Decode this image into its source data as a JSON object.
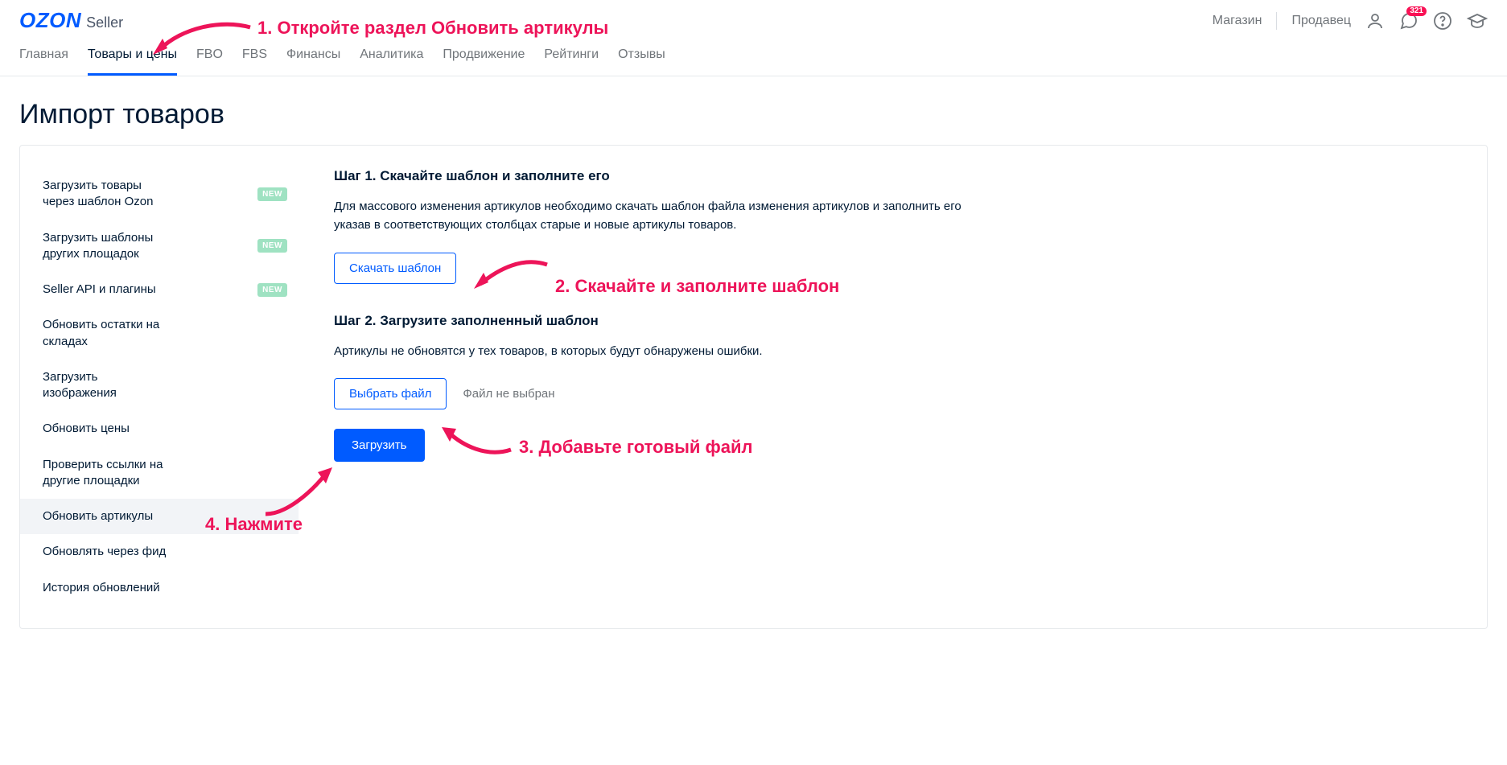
{
  "header": {
    "logo_ozon": "OZON",
    "logo_seller": "Seller",
    "shop_link": "Магазин",
    "seller_link": "Продавец",
    "chat_badge": "321"
  },
  "topnav": {
    "items": [
      {
        "label": "Главная",
        "active": false
      },
      {
        "label": "Товары и цены",
        "active": true
      },
      {
        "label": "FBO",
        "active": false
      },
      {
        "label": "FBS",
        "active": false
      },
      {
        "label": "Финансы",
        "active": false
      },
      {
        "label": "Аналитика",
        "active": false
      },
      {
        "label": "Продвижение",
        "active": false
      },
      {
        "label": "Рейтинги",
        "active": false
      },
      {
        "label": "Отзывы",
        "active": false
      }
    ]
  },
  "page": {
    "title": "Импорт товаров"
  },
  "sidebar": {
    "new_badge": "NEW",
    "items": [
      {
        "label": "Загрузить товары через шаблон Ozon",
        "new": true
      },
      {
        "label": "Загрузить шаблоны других площадок",
        "new": true
      },
      {
        "label": "Seller API и плагины",
        "new": true
      },
      {
        "label": "Обновить остатки на складах",
        "new": false
      },
      {
        "label": "Загрузить изображения",
        "new": false
      },
      {
        "label": "Обновить цены",
        "new": false
      },
      {
        "label": "Проверить ссылки на другие площадки",
        "new": false
      },
      {
        "label": "Обновить артикулы",
        "new": false,
        "active": true
      },
      {
        "label": "Обновлять через фид",
        "new": false
      },
      {
        "label": "История обновлений",
        "new": false
      }
    ]
  },
  "main": {
    "step1_title": "Шаг 1. Скачайте шаблон и заполните его",
    "step1_desc": "Для массового изменения артикулов необходимо скачать шаблон файла изменения артикулов и заполнить его указав в соответствующих столбцах старые и новые артикулы товаров.",
    "download_btn": "Скачать шаблон",
    "step2_title": "Шаг 2. Загрузите заполненный шаблон",
    "step2_desc": "Артикулы не обновятся у тех товаров, в которых будут обнаружены ошибки.",
    "choose_file_btn": "Выбрать файл",
    "file_status": "Файл не выбран",
    "upload_btn": "Загрузить"
  },
  "annotations": {
    "a1": "1. Откройте раздел Обновить артикулы",
    "a2": "2. Скачайте и заполните шаблон",
    "a3": "3. Добавьте готовый файл",
    "a4": "4. Нажмите"
  }
}
